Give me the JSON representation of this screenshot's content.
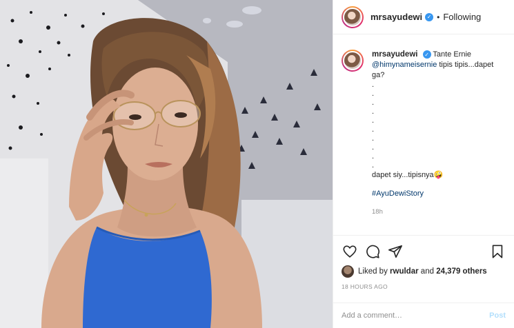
{
  "header": {
    "username": "mrsayudewi",
    "separator": "•",
    "follow_status": "Following",
    "verified_icon": "verified-badge-icon"
  },
  "caption": {
    "username": "mrsayudewi",
    "text_prefix": "Tante Ernie",
    "mention": "@himynameisernie",
    "text_after_mention": "tipis tipis...dapet ga?",
    "dots": [
      ".",
      ".",
      ".",
      ".",
      ".",
      ".",
      ".",
      ".",
      ".",
      "."
    ],
    "line_end": "dapet siy...tipisnya🤪",
    "hashtag": "#AyuDewiStory",
    "time_short": "18h"
  },
  "actions": {
    "like_icon": "heart-icon",
    "comment_icon": "comment-icon",
    "share_icon": "share-icon",
    "save_icon": "bookmark-icon"
  },
  "likes": {
    "prefix": "Liked by",
    "user": "rwuldar",
    "middle": "and",
    "others": "24,379 others"
  },
  "posted_time": "18 HOURS AGO",
  "comment_box": {
    "placeholder": "Add a comment…",
    "post_label": "Post"
  },
  "colors": {
    "link": "#00376b",
    "verified": "#3897f0",
    "muted": "#8e8e8e",
    "post_disabled": "#b2dffc",
    "top_color": "#3a7bd5"
  }
}
